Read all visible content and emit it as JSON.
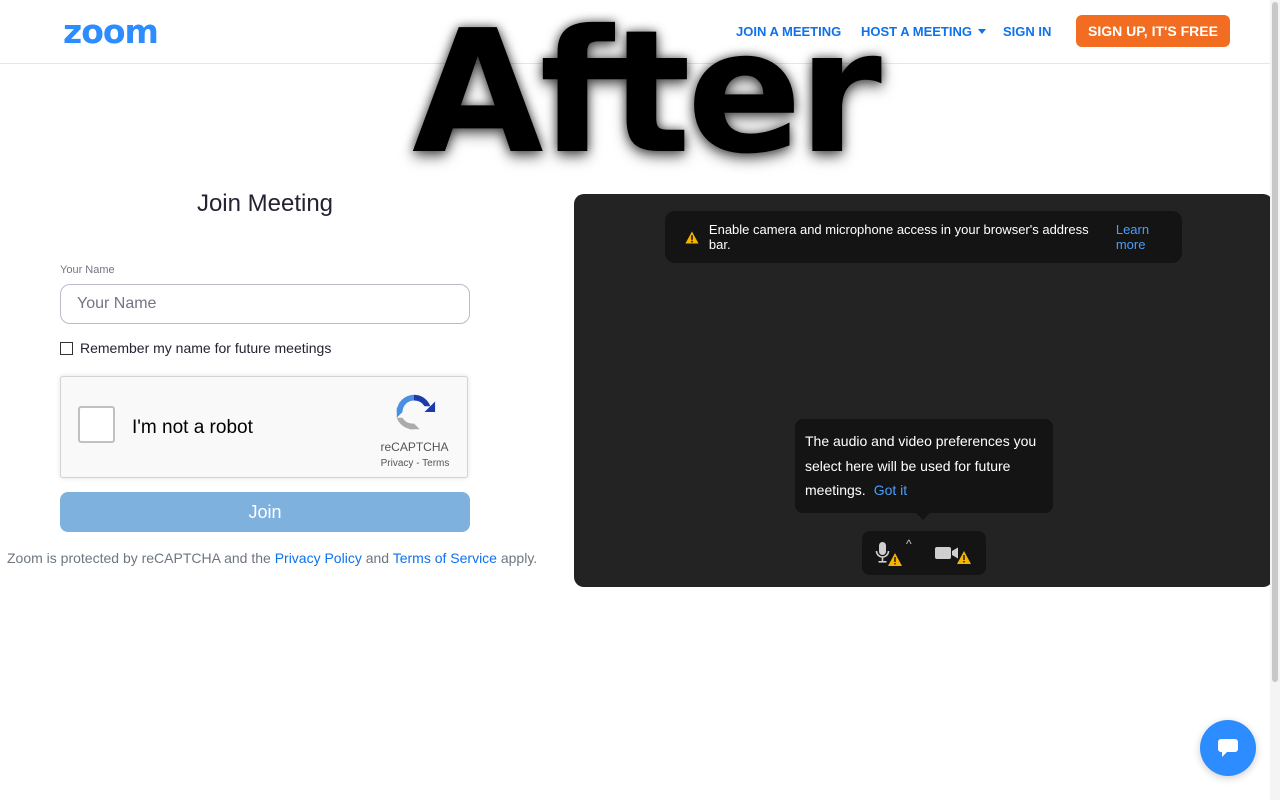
{
  "header": {
    "logo": "zoom",
    "nav": {
      "join_meeting": "JOIN A MEETING",
      "host_meeting": "HOST A MEETING",
      "sign_in": "SIGN IN",
      "sign_up": "SIGN UP, IT'S FREE"
    }
  },
  "overlay_text": "After",
  "join_form": {
    "title": "Join Meeting",
    "name_label": "Your Name",
    "name_placeholder": "Your Name",
    "name_value": "",
    "remember_label": "Remember my name for future meetings",
    "remember_checked": false,
    "recaptcha": {
      "label": "I'm not a robot",
      "brand": "reCAPTCHA",
      "privacy": "Privacy",
      "separator": " - ",
      "terms": "Terms"
    },
    "join_button": "Join",
    "legal": {
      "prefix": "Zoom is protected by reCAPTCHA and the ",
      "privacy_link": "Privacy Policy",
      "middle": " and ",
      "terms_link": "Terms of Service",
      "suffix": " apply."
    }
  },
  "preview": {
    "notice_text": "Enable camera and microphone access in your browser's address bar.",
    "notice_link": "Learn more",
    "tooltip_text": "The audio and video preferences you select here will be used for future meetings.",
    "tooltip_link": "Got it",
    "controls": {
      "mic_icon": "microphone-warning-icon",
      "caret": "^",
      "camera_icon": "camera-warning-icon"
    }
  },
  "chat_icon": "chat-bubble-icon",
  "colors": {
    "brand_blue": "#2d8cff",
    "link_blue": "#0e72ed",
    "signup_orange": "#f26d21",
    "join_disabled": "#7eb1dd",
    "preview_bg": "#232323",
    "warning_yellow": "#f5b400"
  }
}
